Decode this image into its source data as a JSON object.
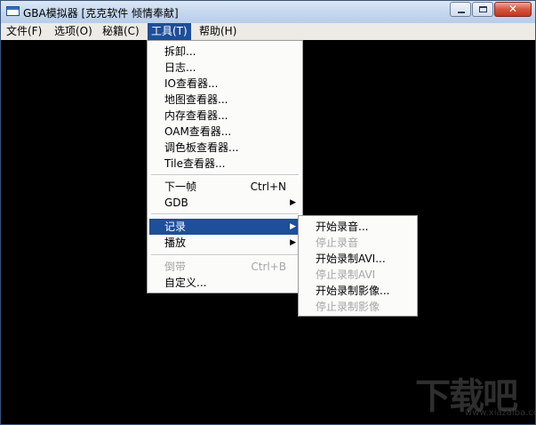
{
  "window": {
    "title": "GBA模拟器 [克克软件 倾情奉献]"
  },
  "menubar": [
    {
      "label": "文件(F)"
    },
    {
      "label": "选项(O)"
    },
    {
      "label": "秘籍(C)"
    },
    {
      "label": "工具(T)",
      "active": true
    },
    {
      "label": "帮助(H)"
    }
  ],
  "tools_menu": {
    "group1": [
      "拆卸...",
      "日志...",
      "IO查看器...",
      "地图查看器...",
      "内存查看器...",
      "OAM查看器...",
      "调色板查看器...",
      "Tile查看器..."
    ],
    "next_frame": {
      "label": "下一帧",
      "shortcut": "Ctrl+N"
    },
    "gdb": {
      "label": "GDB"
    },
    "record": {
      "label": "记录"
    },
    "play": {
      "label": "播放"
    },
    "rewind": {
      "label": "倒带",
      "shortcut": "Ctrl+B"
    },
    "customize": {
      "label": "自定义..."
    }
  },
  "record_submenu": [
    {
      "label": "开始录音...",
      "enabled": true
    },
    {
      "label": "停止录音",
      "enabled": false
    },
    {
      "label": "开始录制AVI...",
      "enabled": true
    },
    {
      "label": "停止录制AVI",
      "enabled": false
    },
    {
      "label": "开始录制影像...",
      "enabled": true
    },
    {
      "label": "停止录制影像",
      "enabled": false
    }
  ],
  "watermark": {
    "text": "下载吧",
    "url": "www.xiazaiba.com"
  },
  "colors": {
    "highlight": "#1d4f9a",
    "canvas": "#000000",
    "menu_bg": "#fbfbfa",
    "disabled": "#a7a7a7"
  }
}
